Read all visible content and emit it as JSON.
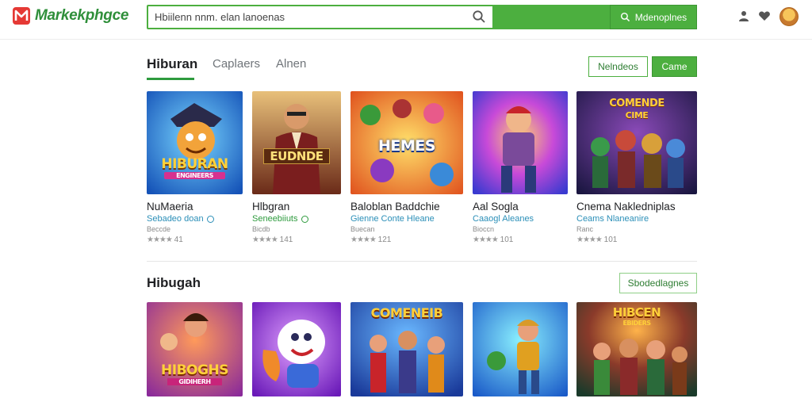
{
  "header": {
    "logo_text": "Markekphgce",
    "search_value": "Hbiilenn nnm. elan lanoenas",
    "search_button_label": "Mdenoplnes"
  },
  "tabs": [
    {
      "label": "Hiburan"
    },
    {
      "label": "Caplaers"
    },
    {
      "label": "Alnen"
    }
  ],
  "toolbar": {
    "outline_label": "Nelndeos",
    "fill_label": "Came"
  },
  "section2": {
    "title": "Hibugah",
    "button_label": "Sbodedlagnes"
  },
  "row1": [
    {
      "title": "NuMaeria",
      "sub": "Sebadeo doan",
      "meta": "Beccde",
      "rating": "41",
      "thumb_text": "HIBURAN",
      "thumb_text2": "ENGINEERS"
    },
    {
      "title": "Hlbgran",
      "sub": "Seneebiiuts",
      "meta": "Bicdb",
      "rating": "141",
      "thumb_text": "EUDNDE",
      "thumb_text2": ""
    },
    {
      "title": "Baloblan Baddchie",
      "sub": "Gienne Conte Hleane",
      "meta": "Buecan",
      "rating": "121",
      "thumb_text": "HEMES",
      "thumb_text2": ""
    },
    {
      "title": "Aal Sogla",
      "sub": "Caaogl Aleanes",
      "meta": "Bioccn",
      "rating": "101",
      "thumb_text": "",
      "thumb_text2": ""
    },
    {
      "title": "Cnema Nakledniplas",
      "sub": "Ceams Nlaneanire",
      "meta": "Ranc",
      "rating": "101",
      "thumb_text": "COMENDE",
      "thumb_text2": "CIME"
    }
  ],
  "row2": [
    {
      "thumb_text": "HIBOGHS",
      "thumb_text2": "GIDIHERH"
    },
    {
      "thumb_text": "",
      "thumb_text2": ""
    },
    {
      "thumb_text": "COMENEIB",
      "thumb_text2": ""
    },
    {
      "thumb_text": "",
      "thumb_text2": ""
    },
    {
      "thumb_text": "HIBCEN",
      "thumb_text2": "EBIDERS"
    }
  ],
  "colors": {
    "brand_green": "#4caf3f",
    "link_blue": "#2b8fb8"
  }
}
